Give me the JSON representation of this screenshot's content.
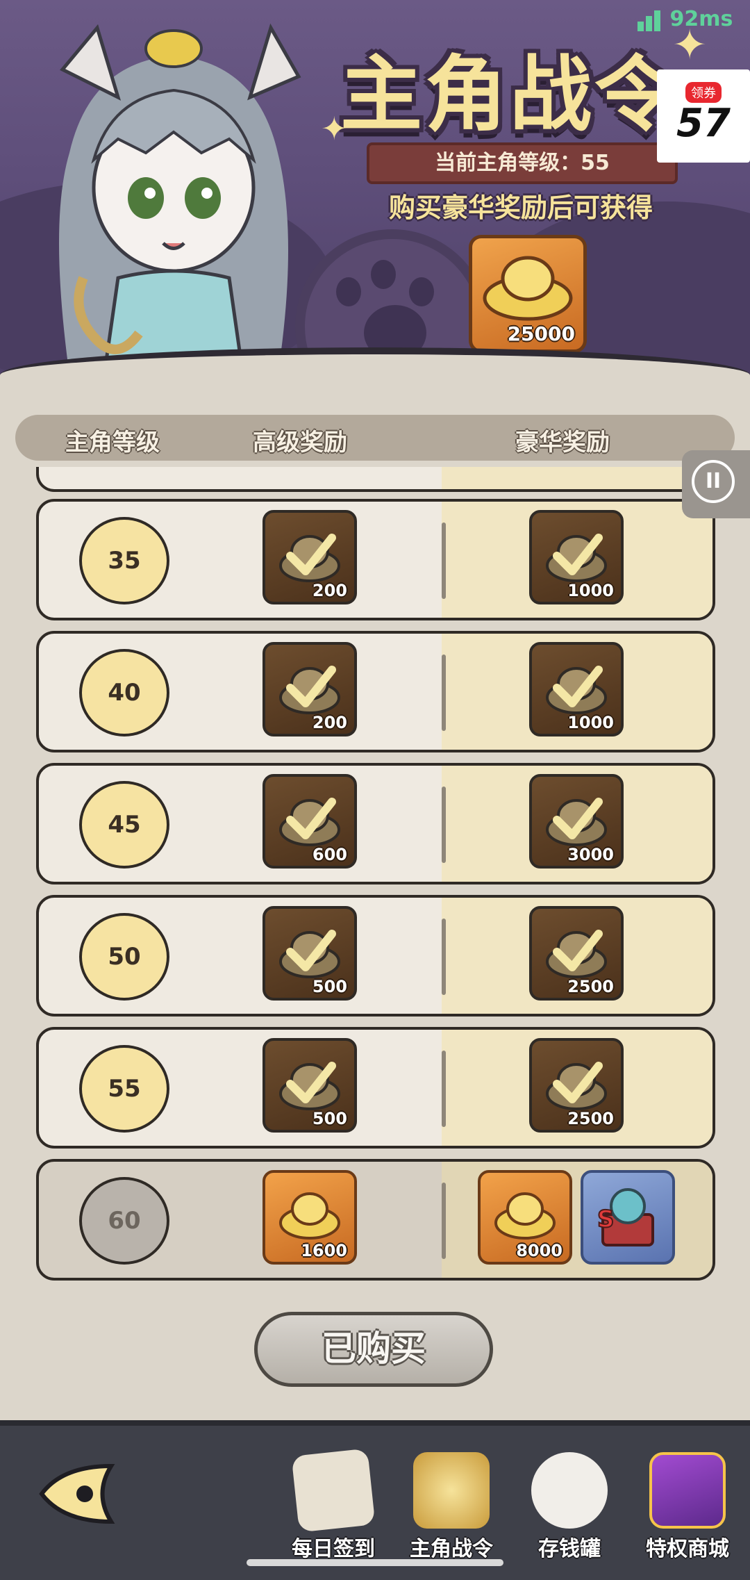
{
  "status": {
    "latency": "92ms",
    "coupon_tag": "领券",
    "coupon_logo": "57"
  },
  "header": {
    "title": "主角战令",
    "current_level_label": "当前主角等级：55",
    "subtitle": "购买豪华奖励后可获得",
    "featured_reward_amount": "25000"
  },
  "table": {
    "columns": [
      "主角等级",
      "高级奖励",
      "豪华奖励"
    ],
    "rows": [
      {
        "level": "35",
        "advanced": "200",
        "luxury": "1000",
        "state": "claimed"
      },
      {
        "level": "40",
        "advanced": "200",
        "luxury": "1000",
        "state": "claimed"
      },
      {
        "level": "45",
        "advanced": "600",
        "luxury": "3000",
        "state": "claimed"
      },
      {
        "level": "50",
        "advanced": "500",
        "luxury": "2500",
        "state": "claimed"
      },
      {
        "level": "55",
        "advanced": "500",
        "luxury": "2500",
        "state": "claimed"
      },
      {
        "level": "60",
        "advanced": "1600",
        "luxury": "8000",
        "state": "locked"
      }
    ]
  },
  "purchase_button": {
    "label": "已购买"
  },
  "bottom_nav": {
    "items": [
      {
        "label": "每日签到",
        "icon": "scroll-quill-icon"
      },
      {
        "label": "主角战令",
        "icon": "battle-pass-icon"
      },
      {
        "label": "存钱罐",
        "icon": "lucky-cat-icon"
      },
      {
        "label": "特权商城",
        "icon": "gift-box-icon"
      }
    ]
  },
  "colors": {
    "gold": "#f6e39b",
    "panel": "#dcd6cb",
    "nav": "#3e4049"
  }
}
